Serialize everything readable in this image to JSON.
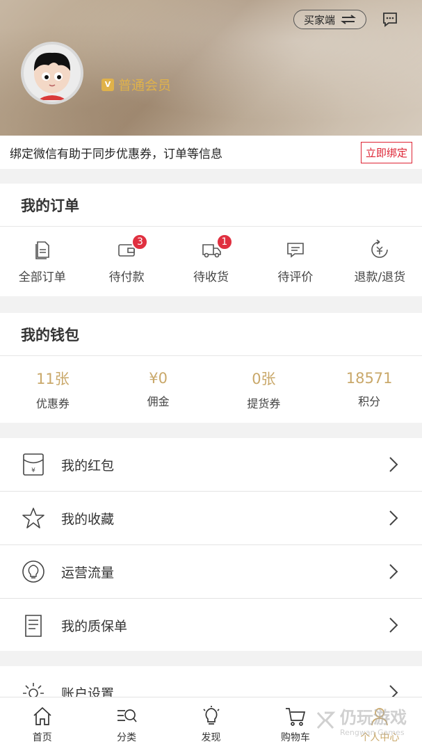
{
  "header": {
    "mode_label": "买家端",
    "member_level": "普通会员"
  },
  "bind_bar": {
    "text": "绑定微信有助于同步优惠券，订单等信息",
    "button": "立即绑定"
  },
  "orders": {
    "title": "我的订单",
    "items": [
      {
        "label": "全部订单",
        "icon": "document-icon",
        "badge": ""
      },
      {
        "label": "待付款",
        "icon": "wallet-icon",
        "badge": "3"
      },
      {
        "label": "待收货",
        "icon": "truck-icon",
        "badge": "1"
      },
      {
        "label": "待评价",
        "icon": "comment-icon",
        "badge": ""
      },
      {
        "label": "退款/退货",
        "icon": "refund-icon",
        "badge": ""
      }
    ]
  },
  "wallet": {
    "title": "我的钱包",
    "items": [
      {
        "value": "11张",
        "label": "优惠券"
      },
      {
        "value": "¥0",
        "label": "佣金"
      },
      {
        "value": "0张",
        "label": "提货券"
      },
      {
        "value": "18571",
        "label": "积分"
      }
    ]
  },
  "menu": {
    "items": [
      {
        "label": "我的红包",
        "icon": "red-envelope-icon"
      },
      {
        "label": "我的收藏",
        "icon": "star-icon"
      },
      {
        "label": "运营流量",
        "icon": "lightbulb-icon"
      },
      {
        "label": "我的质保单",
        "icon": "warranty-doc-icon"
      }
    ],
    "settings_label": "账户设置"
  },
  "tabbar": {
    "items": [
      {
        "label": "首页",
        "icon": "home-icon"
      },
      {
        "label": "分类",
        "icon": "category-icon"
      },
      {
        "label": "发现",
        "icon": "discover-icon"
      },
      {
        "label": "购物车",
        "icon": "cart-icon"
      },
      {
        "label": "个人中心",
        "icon": "user-icon"
      }
    ],
    "active": "个人中心"
  },
  "watermark": {
    "title": "仍玩游戏",
    "subtitle": "Rengwan Games"
  },
  "colors": {
    "accent_gold": "#c9a86a",
    "badge_red": "#e03040",
    "bind_red": "#dd2233"
  }
}
